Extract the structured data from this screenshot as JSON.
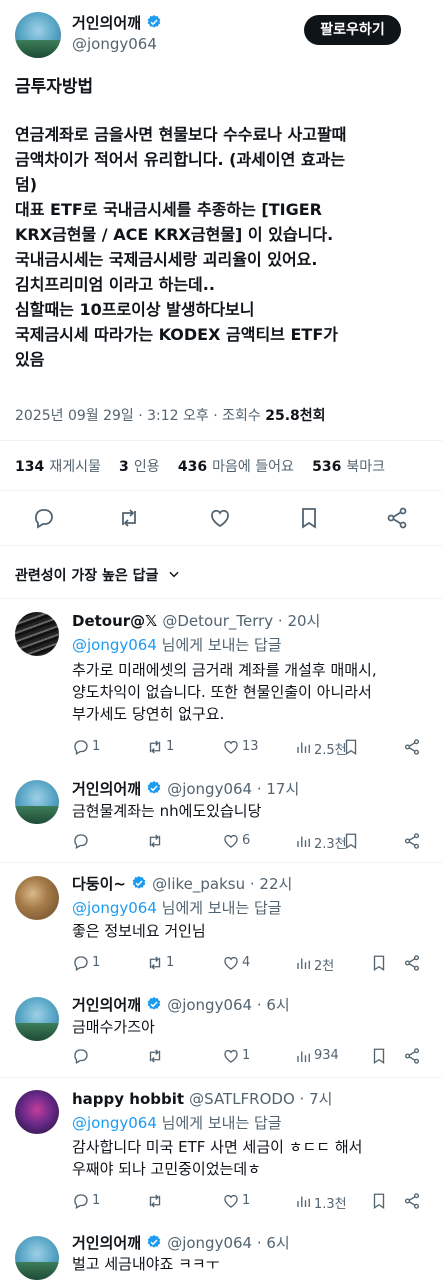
{
  "post": {
    "author_name": "거인의어깨",
    "author_handle": "@jongy064",
    "follow_label": "팔로우하기",
    "title": "금투자방법",
    "lines": [
      "연금계좌로 금을사면 현물보다 수수료나 사고팔때",
      "금액차이가 적어서 유리합니다. (과세이연 효과는",
      "덤)",
      "대표 ETF로 국내금시세를 추종하는 [TIGER",
      "KRX금현물 / ACE KRX금현물] 이 있습니다.",
      "국내금시세는 국제금시세랑 괴리율이 있어요.",
      "김치프리미엄 이라고 하는데..",
      "심할때는 10프로이상 발생하다보니",
      "국제금시세 따라가는 KODEX 금액티브 ETF가",
      "있음"
    ],
    "timestamp": "2025년 09월 29일 · 3:12 오후 · 조회수",
    "views": "25.8천회",
    "stats": [
      {
        "num": "134",
        "label": "재게시물"
      },
      {
        "num": "3",
        "label": "인용"
      },
      {
        "num": "436",
        "label": "마음에 들어요"
      },
      {
        "num": "536",
        "label": "북마크"
      }
    ]
  },
  "sort_label": "관련성이 가장 높은 답글",
  "replies": [
    {
      "name": "Detour@𝕏",
      "handle": "@Detour_Terry · 20시",
      "replying_to": "@jongy064",
      "replying_suffix": "님에게 보내는 답글",
      "text": [
        "추가로 미래에셋의 금거래 계좌를 개설후 매매시,",
        "양도차익이 없습니다. 또한 현물인출이 아니라서",
        "부가세도 당연히 없구요."
      ],
      "replies": "1",
      "reposts": "1",
      "likes": "13",
      "views": "2.5천",
      "avatar": "dark",
      "verified": false
    },
    {
      "name": "거인의어깨",
      "handle": "@jongy064 · 17시",
      "text": [
        "금현물계좌는 nh에도있습니당"
      ],
      "replies": "",
      "reposts": "",
      "likes": "6",
      "views": "2.3천",
      "avatar": "palm",
      "verified": true
    },
    {
      "name": "다둥이~",
      "handle": "@like_paksu · 22시",
      "replying_to": "@jongy064",
      "replying_suffix": "님에게 보내는 답글",
      "text": [
        "좋은 정보네요 거인님"
      ],
      "replies": "1",
      "reposts": "1",
      "likes": "4",
      "views": "2천",
      "avatar": "food",
      "verified": true
    },
    {
      "name": "거인의어깨",
      "handle": "@jongy064 · 6시",
      "text": [
        "금매수가즈아"
      ],
      "replies": "",
      "reposts": "",
      "likes": "1",
      "views": "934",
      "avatar": "palm",
      "verified": true
    },
    {
      "name": "happy hobbit",
      "handle": "@SATLFRODO · 7시",
      "replying_to": "@jongy064",
      "replying_suffix": "님에게 보내는 답글",
      "text": [
        "감사합니다 미국 ETF 사면 세금이 ㅎㄷㄷ 해서",
        "우째야 되나 고민중이었는데ㅎ"
      ],
      "replies": "1",
      "reposts": "",
      "likes": "1",
      "views": "1.3천",
      "avatar": "hobbit",
      "verified": false
    },
    {
      "name": "거인의어깨",
      "handle": "@jongy064 · 6시",
      "text": [
        "벌고 세금내야죠 ㅋㅋㅜ"
      ],
      "avatar": "palm",
      "verified": true
    }
  ],
  "icons": {
    "reply": "reply-icon",
    "repost": "repost-icon",
    "like": "like-icon",
    "views": "views-icon",
    "bookmark": "bookmark-icon",
    "share": "share-icon",
    "verified": "verified-badge-icon",
    "chevron": "chevron-down-icon"
  },
  "colors": {
    "accent": "#1d9bf0",
    "text": "#0f1419",
    "muted": "#536471",
    "button": "#0f1419"
  }
}
